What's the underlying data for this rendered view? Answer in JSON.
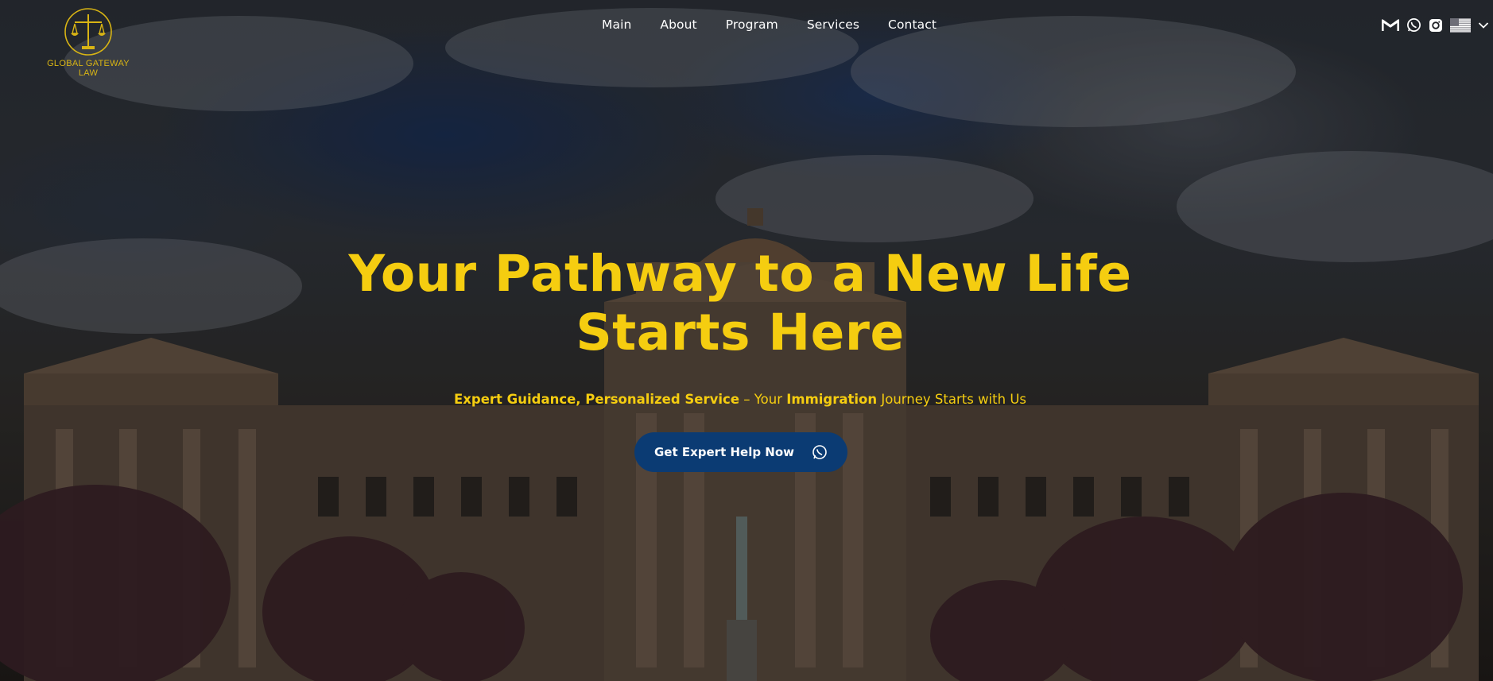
{
  "brand": {
    "logo_text": "GLOBAL GATEWAY LAW",
    "accent_color": "#f5cd10",
    "button_color": "#0b3b73",
    "logo_icon": "scales-of-justice-icon"
  },
  "nav": {
    "items": [
      {
        "label": "Main"
      },
      {
        "label": "About"
      },
      {
        "label": "Program"
      },
      {
        "label": "Services"
      },
      {
        "label": "Contact"
      }
    ]
  },
  "header_icons": [
    "gmail-icon",
    "whatsapp-icon",
    "instagram-icon",
    "us-flag-icon",
    "chevron-down-icon"
  ],
  "hero": {
    "headline_line1": "Your Pathway to a New Life",
    "headline_line2": "Starts Here",
    "sub_part1": "Expert Guidance, Personalized Service",
    "sub_part2": " – Your ",
    "sub_part3": "Immigration",
    "sub_part4": " Journey Starts with Us",
    "cta_label": "Get Expert Help Now",
    "cta_icon": "whatsapp-icon"
  }
}
